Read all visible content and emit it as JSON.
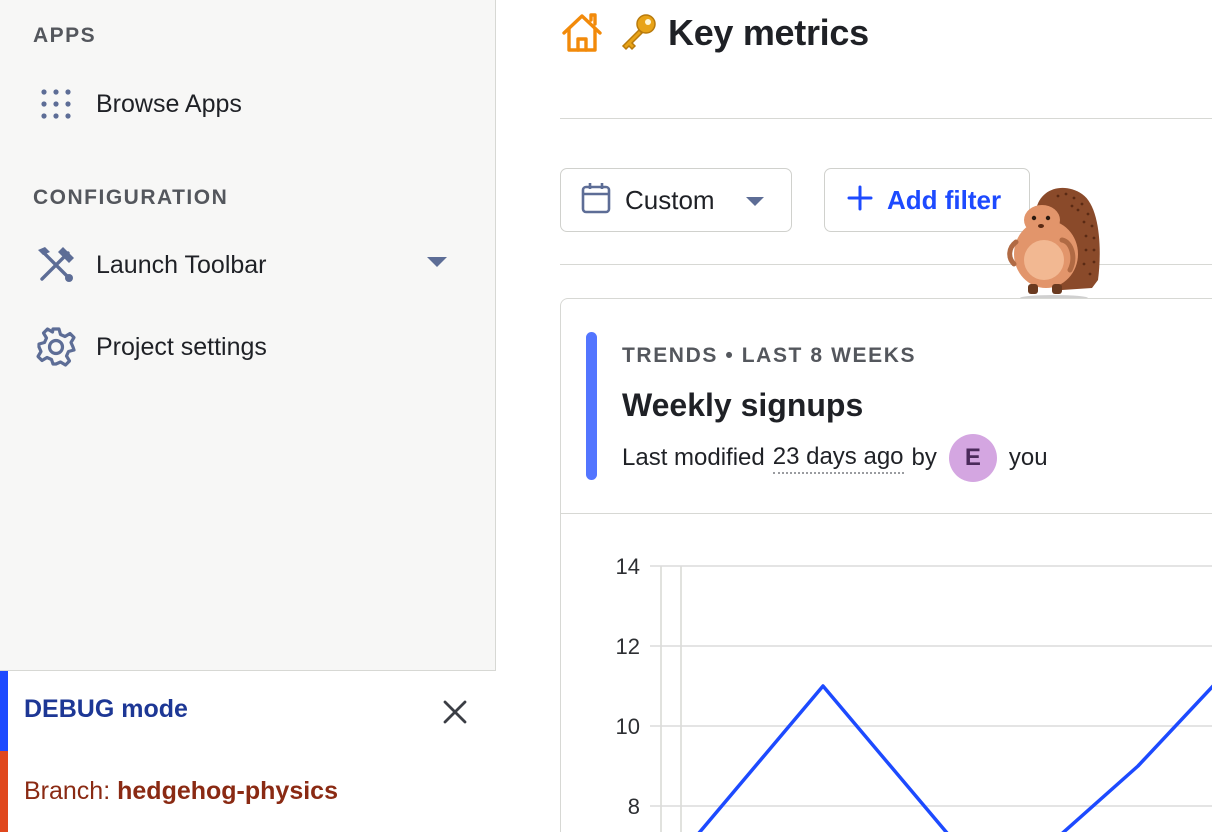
{
  "sidebar": {
    "apps_title": "APPS",
    "browse_apps": "Browse Apps",
    "configuration_title": "CONFIGURATION",
    "launch_toolbar": "Launch Toolbar",
    "project_settings": "Project settings",
    "debug_label": "DEBUG mode",
    "branch_prefix": "Branch:",
    "branch_name": "hedgehog-physics"
  },
  "header": {
    "title": "Key metrics",
    "home_icon": "home-icon",
    "title_emoji": "key-icon"
  },
  "filters": {
    "date_range": "Custom",
    "add_filter": "Add filter"
  },
  "card": {
    "kicker": "TRENDS • LAST 8 WEEKS",
    "title": "Weekly signups",
    "meta_prefix": "Last modified",
    "meta_time": "23 days ago",
    "meta_by": "by",
    "avatar_initial": "E",
    "meta_author": "you"
  },
  "colors": {
    "accent": "#1d4aff",
    "series_line": "#1d4aff",
    "debug_accent": "#1d4aff",
    "branch_accent": "#e0471d",
    "avatar_bg": "#d4a6e1"
  },
  "chart_data": {
    "type": "line",
    "title": "",
    "xlabel": "",
    "ylabel": "",
    "y_ticks": [
      14,
      12,
      10,
      8
    ],
    "ylim": [
      6.5,
      14
    ],
    "grid": true,
    "series": [
      {
        "values": [
          7,
          11,
          7,
          7,
          9,
          11.4
        ]
      }
    ]
  }
}
